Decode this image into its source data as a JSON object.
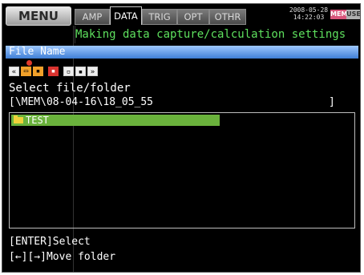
{
  "top_bar": {
    "menu_label": "MENU",
    "tabs": [
      {
        "label": "AMP",
        "active": false
      },
      {
        "label": "DATA",
        "active": true
      },
      {
        "label": "TRIG",
        "active": false
      },
      {
        "label": "OPT",
        "active": false
      },
      {
        "label": "OTHR",
        "active": false
      }
    ],
    "date": "2008-05-28",
    "time": "14:22:03",
    "mem_badge": "MEM",
    "use_badge": "USE"
  },
  "subtitle": "Making data capture/calculation settings",
  "header_label": "File Name",
  "toolbar_icons": [
    "rewind-icon",
    "folder-icon",
    "save-icon",
    "delete-icon",
    "copy-icon",
    "info-icon",
    "forward-icon"
  ],
  "prompt": "Select file/folder",
  "current_path": "[\\MEM\\08-04-16\\18_05_55",
  "path_close_bracket": "]",
  "list": {
    "items": [
      {
        "name": "TEST",
        "selected": true
      }
    ]
  },
  "hints": {
    "enter": "[ENTER]Select",
    "arrows": "[←][→]Move folder"
  },
  "colors": {
    "accent_green": "#5ee05e",
    "selection_green": "#6ab23c",
    "header_blue": "#3f7fd6"
  }
}
